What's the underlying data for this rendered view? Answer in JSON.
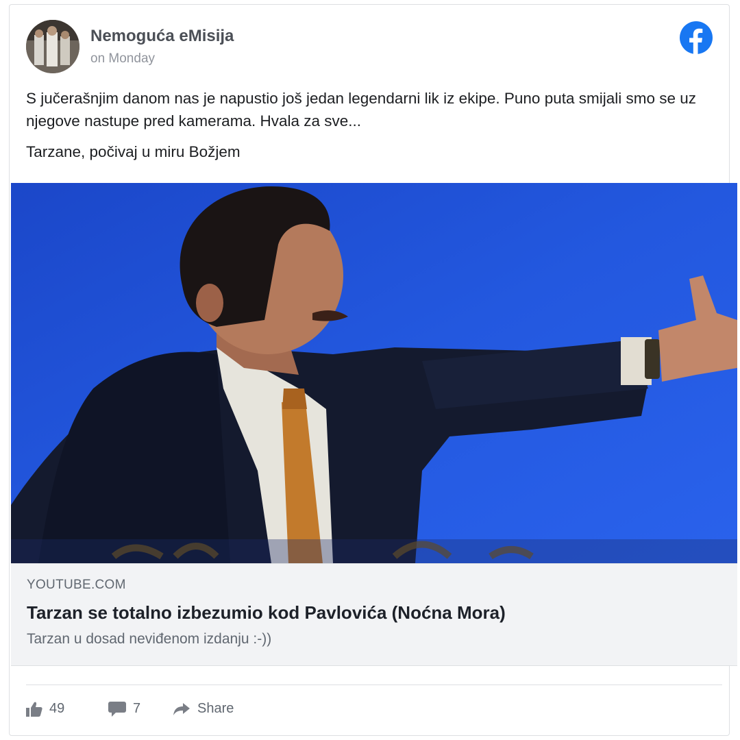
{
  "post": {
    "page_name": "Nemoguća eMisija",
    "time": "on Monday",
    "text_line1": "S jučerašnjim danom nas je napustio još jedan legendarni lik iz ekipe. Puno puta smijali smo se uz njegove nastupe pred kamerama. Hvala za sve...",
    "text_line2": "Tarzane, počivaj u miru Božjem"
  },
  "link": {
    "domain": "YOUTUBE.COM",
    "title": "Tarzan se totalno izbezumio kod Pavlovića (Noćna Mora)",
    "description": "Tarzan u dosad neviđenom izdanju :-))"
  },
  "actions": {
    "likes": "49",
    "comments": "7",
    "share_label": "Share"
  },
  "icons": {
    "logo": "facebook-icon",
    "like": "thumbs-up-icon",
    "comment": "comment-icon",
    "share": "share-arrow-icon"
  },
  "colors": {
    "facebook_blue": "#1877f2",
    "video_background": "#1f52d6",
    "link_box": "#f2f3f5"
  }
}
